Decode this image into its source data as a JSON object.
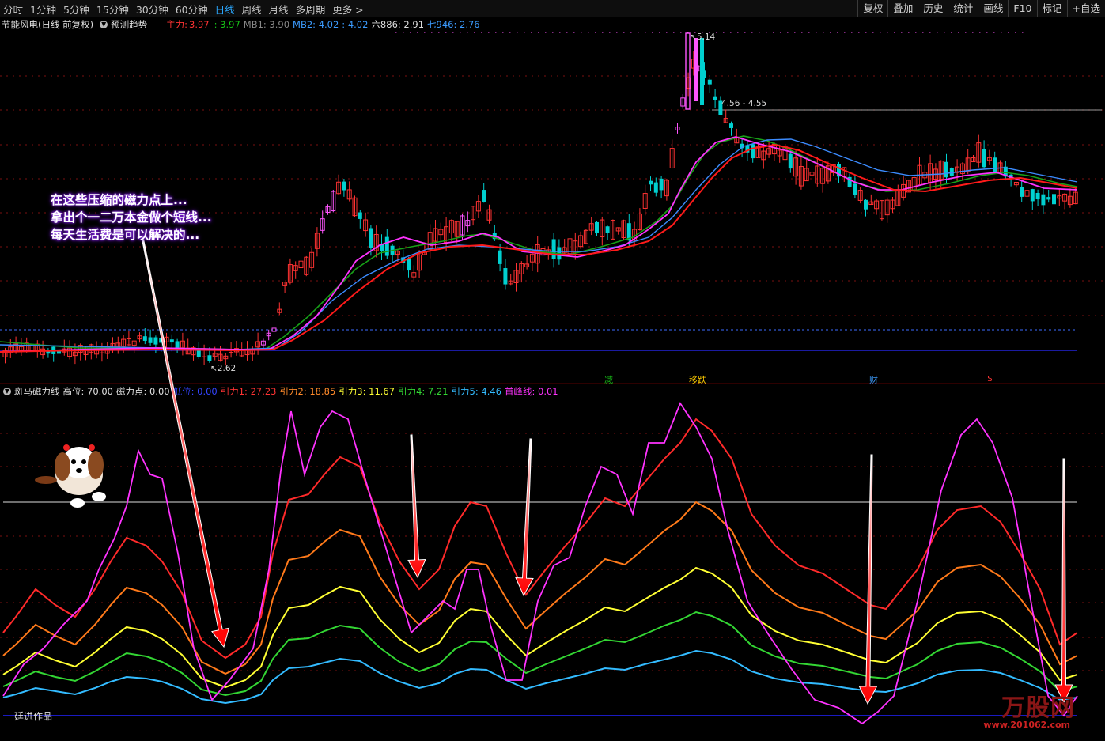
{
  "toolbar": {
    "periods": [
      "分时",
      "1分钟",
      "5分钟",
      "15分钟",
      "30分钟",
      "60分钟",
      "日线",
      "周线",
      "月线",
      "多周期",
      "更多 >"
    ],
    "active_period": "日线",
    "actions": [
      "复权",
      "叠加",
      "历史",
      "统计",
      "画线",
      "F10",
      "标记",
      "+自选"
    ]
  },
  "main_info": {
    "title": "节能风电(日线 前复权)",
    "indicator": "预测趋势",
    "zhuli_label": "主力:",
    "zhuli_value": "3.97",
    "g_value": ": 3.97",
    "mb1": "MB1: 3.90",
    "mb2": "MB2: 4.02",
    "v4": ": 4.02",
    "liu": "六886: 2.91",
    "qi": "七946: 2.76"
  },
  "price_labels": {
    "high": "5.14",
    "low": "2.62",
    "range": "4.56 - 4.55"
  },
  "signals": [
    "减",
    "移跌",
    "财",
    "$"
  ],
  "callout": [
    "在这些压缩的磁力点上...",
    "拿出个一二万本金做个短线...",
    "每天生活费是可以解决的..."
  ],
  "sub_info": {
    "title": "斑马磁力线",
    "gaowei": "高位: 70.00",
    "cilidian": "磁力点: 0.00",
    "diwei": "低位: 0.00",
    "y1": "引力1: 27.23",
    "y2": "引力2: 18.85",
    "y3": "引力3: 11.67",
    "y4": "引力4: 7.21",
    "y5": "引力5: 4.46",
    "fx": "首峰线: 0.01"
  },
  "author": "廷进作品",
  "watermark": {
    "brand": "万股网",
    "url": "www.201062.com"
  },
  "colors": {
    "up": "#ff3232",
    "down": "#00d0d0",
    "up_pink": "#ff55ff",
    "ma_pink": "#ff33ff",
    "ma_red": "#ff1a1a",
    "ma_green": "#17a017",
    "ma_blue": "#3c8cff",
    "y1": "#ff2a2a",
    "y2": "#ff7a1a",
    "y3": "#ffff33",
    "y4": "#33d633",
    "y5": "#33bbff",
    "fx": "#ff33ff"
  }
}
